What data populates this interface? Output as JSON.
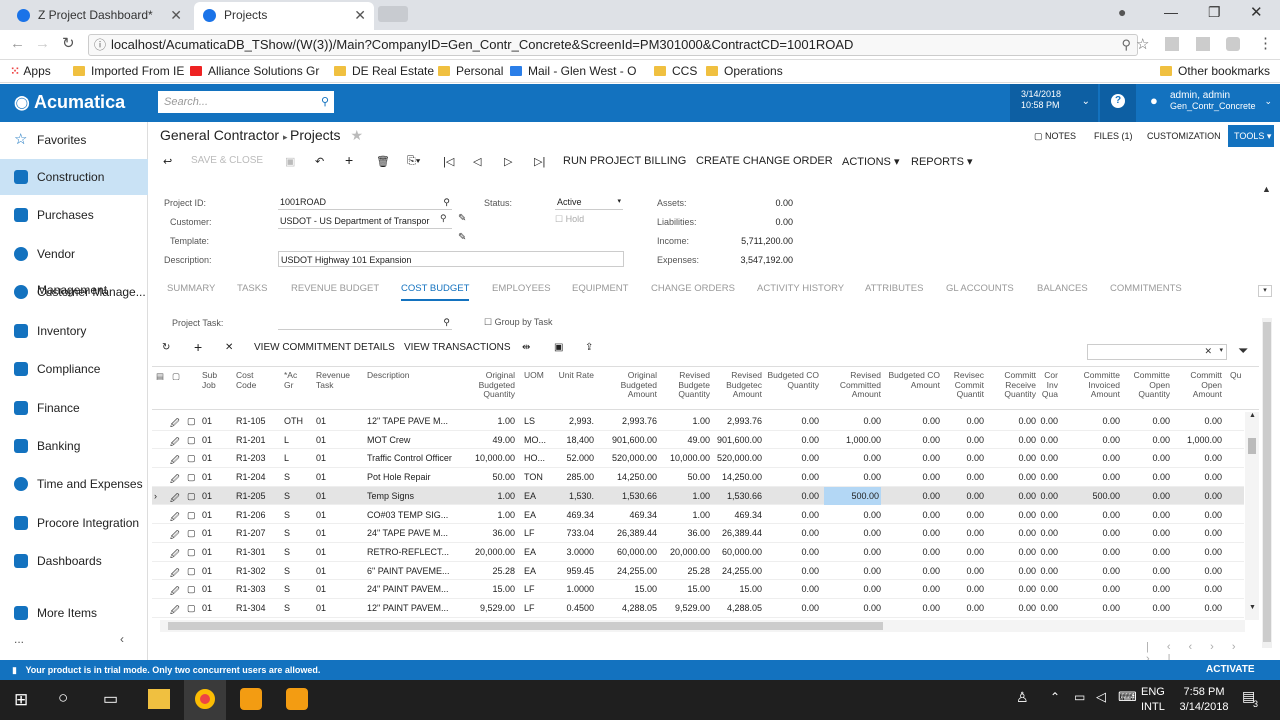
{
  "browser": {
    "tabs": [
      {
        "label": "Z Project Dashboard*"
      },
      {
        "label": "Projects"
      }
    ],
    "url": "localhost/AcumaticaDB_TShow/(W(3))/Main?CompanyID=Gen_Contr_Concrete&ScreenId=PM301000&ContractCD=1001ROAD",
    "bookmarks": [
      "Apps",
      "Imported From IE",
      "Alliance Solutions Gr",
      "DE Real Estate",
      "Personal",
      "Mail - Glen West - O",
      "CCS",
      "Operations"
    ],
    "other_bookmarks": "Other bookmarks"
  },
  "header": {
    "logo": "Acumatica",
    "search_placeholder": "Search...",
    "date": "3/14/2018",
    "time": "10:58 PM",
    "user": "admin, admin",
    "company": "Gen_Contr_Concrete"
  },
  "sidebar": {
    "items": [
      "Favorites",
      "Construction",
      "Purchases",
      "Vendor Management",
      "Customer Manage...",
      "Inventory",
      "Compliance",
      "Finance",
      "Banking",
      "Time and Expenses",
      "Procore Integration",
      "Dashboards",
      "More Items"
    ],
    "more": "..."
  },
  "page": {
    "module": "General Contractor",
    "title": "Projects",
    "top_links": [
      "NOTES",
      "FILES (1)",
      "CUSTOMIZATION"
    ],
    "tools": "TOOLS"
  },
  "toolbar": {
    "save_close": "SAVE & CLOSE",
    "run_billing": "RUN PROJECT BILLING",
    "change_order": "CREATE CHANGE ORDER",
    "actions": "ACTIONS",
    "reports": "REPORTS"
  },
  "form": {
    "project_id_label": "Project ID:",
    "project_id": "1001ROAD",
    "customer_label": "Customer:",
    "customer": "USDOT - US Department of Transpor",
    "template_label": "Template:",
    "description_label": "Description:",
    "description": "USDOT Highway 101 Expansion",
    "status_label": "Status:",
    "status": "Active",
    "hold_label": "Hold",
    "assets_label": "Assets:",
    "assets": "0.00",
    "liabilities_label": "Liabilities:",
    "liabilities": "0.00",
    "income_label": "Income:",
    "income": "5,711,200.00",
    "expenses_label": "Expenses:",
    "expenses": "3,547,192.00"
  },
  "tabs": [
    "SUMMARY",
    "TASKS",
    "REVENUE BUDGET",
    "COST BUDGET",
    "EMPLOYEES",
    "EQUIPMENT",
    "CHANGE ORDERS",
    "ACTIVITY HISTORY",
    "ATTRIBUTES",
    "GL ACCOUNTS",
    "BALANCES",
    "COMMITMENTS"
  ],
  "active_tab": "COST BUDGET",
  "cost_budget": {
    "project_task_label": "Project Task:",
    "group_by_task": "Group by Task",
    "view_commitment": "VIEW COMMITMENT DETAILS",
    "view_transactions": "VIEW TRANSACTIONS",
    "columns": [
      "Sub Job",
      "Cost Code",
      "*Ac Gr",
      "Revenue Task",
      "Description",
      "Original Budgeted Quantity",
      "UOM",
      "Unit Rate",
      "Original Budgeted Amount",
      "Revised Budgete Quantity",
      "Revised Budgetec Amount",
      "Budgeted CO Quantity",
      "Revised Committed Amount",
      "Budgeted CO Amount",
      "Revisec Commit Quantit",
      "Committ Receive Quantity",
      "Cor Inv Qua",
      "Committe Invoiced Amount",
      "Committe Open Quantity",
      "Committ Open Amount",
      "Qu"
    ],
    "rows": [
      [
        "01",
        "R1-105",
        "OTH",
        "01",
        "12\" TAPE PAVE M...",
        "1.00",
        "LS",
        "2,993.",
        "2,993.76",
        "1.00",
        "2,993.76",
        "0.00",
        "0.00",
        "0.00",
        "0.00",
        "0.00",
        "0.00",
        "0.00",
        "0.00",
        "0.00"
      ],
      [
        "01",
        "R1-201",
        "L",
        "01",
        "MOT Crew",
        "49.00",
        "MO...",
        "18,400",
        "901,600.00",
        "49.00",
        "901,600.00",
        "0.00",
        "1,000.00",
        "0.00",
        "0.00",
        "0.00",
        "0.00",
        "0.00",
        "0.00",
        "1,000.00"
      ],
      [
        "01",
        "R1-203",
        "L",
        "01",
        "Traffic Control Officer",
        "10,000.00",
        "HO...",
        "52.000",
        "520,000.00",
        "10,000.00",
        "520,000.00",
        "0.00",
        "0.00",
        "0.00",
        "0.00",
        "0.00",
        "0.00",
        "0.00",
        "0.00",
        "0.00"
      ],
      [
        "01",
        "R1-204",
        "S",
        "01",
        "Pot Hole Repair",
        "50.00",
        "TON",
        "285.00",
        "14,250.00",
        "50.00",
        "14,250.00",
        "0.00",
        "0.00",
        "0.00",
        "0.00",
        "0.00",
        "0.00",
        "0.00",
        "0.00",
        "0.00"
      ],
      [
        "01",
        "R1-205",
        "S",
        "01",
        "Temp Signs",
        "1.00",
        "EA",
        "1,530.",
        "1,530.66",
        "1.00",
        "1,530.66",
        "0.00",
        "500.00",
        "0.00",
        "0.00",
        "0.00",
        "0.00",
        "500.00",
        "0.00",
        "0.00"
      ],
      [
        "01",
        "R1-206",
        "S",
        "01",
        "CO#03 TEMP SIG...",
        "1.00",
        "EA",
        "469.34",
        "469.34",
        "1.00",
        "469.34",
        "0.00",
        "0.00",
        "0.00",
        "0.00",
        "0.00",
        "0.00",
        "0.00",
        "0.00",
        "0.00"
      ],
      [
        "01",
        "R1-207",
        "S",
        "01",
        "24\" TAPE PAVE M...",
        "36.00",
        "LF",
        "733.04",
        "26,389.44",
        "36.00",
        "26,389.44",
        "0.00",
        "0.00",
        "0.00",
        "0.00",
        "0.00",
        "0.00",
        "0.00",
        "0.00",
        "0.00"
      ],
      [
        "01",
        "R1-301",
        "S",
        "01",
        "RETRO-REFLECT...",
        "20,000.00",
        "EA",
        "3.0000",
        "60,000.00",
        "20,000.00",
        "60,000.00",
        "0.00",
        "0.00",
        "0.00",
        "0.00",
        "0.00",
        "0.00",
        "0.00",
        "0.00",
        "0.00"
      ],
      [
        "01",
        "R1-302",
        "S",
        "01",
        "6\" PAINT PAVEME...",
        "25.28",
        "EA",
        "959.45",
        "24,255.00",
        "25.28",
        "24,255.00",
        "0.00",
        "0.00",
        "0.00",
        "0.00",
        "0.00",
        "0.00",
        "0.00",
        "0.00",
        "0.00"
      ],
      [
        "01",
        "R1-303",
        "S",
        "01",
        "24\" PAINT PAVEM...",
        "15.00",
        "LF",
        "1.0000",
        "15.00",
        "15.00",
        "15.00",
        "0.00",
        "0.00",
        "0.00",
        "0.00",
        "0.00",
        "0.00",
        "0.00",
        "0.00",
        "0.00"
      ],
      [
        "01",
        "R1-304",
        "S",
        "01",
        "12\" PAINT PAVEM...",
        "9,529.00",
        "LF",
        "0.4500",
        "4,288.05",
        "9,529.00",
        "4,288.05",
        "0.00",
        "0.00",
        "0.00",
        "0.00",
        "0.00",
        "0.00",
        "0.00",
        "0.00",
        "0.00"
      ]
    ]
  },
  "status_bar": {
    "message": "Your product is in trial mode. Only two concurrent users are allowed.",
    "activate": "ACTIVATE"
  },
  "taskbar": {
    "lang": "ENG",
    "layout": "INTL",
    "time": "7:58 PM",
    "date": "3/14/2018",
    "notifications": "3"
  },
  "colors": {
    "brand": "#1372bf",
    "active_nav": "#c9e2f5"
  }
}
